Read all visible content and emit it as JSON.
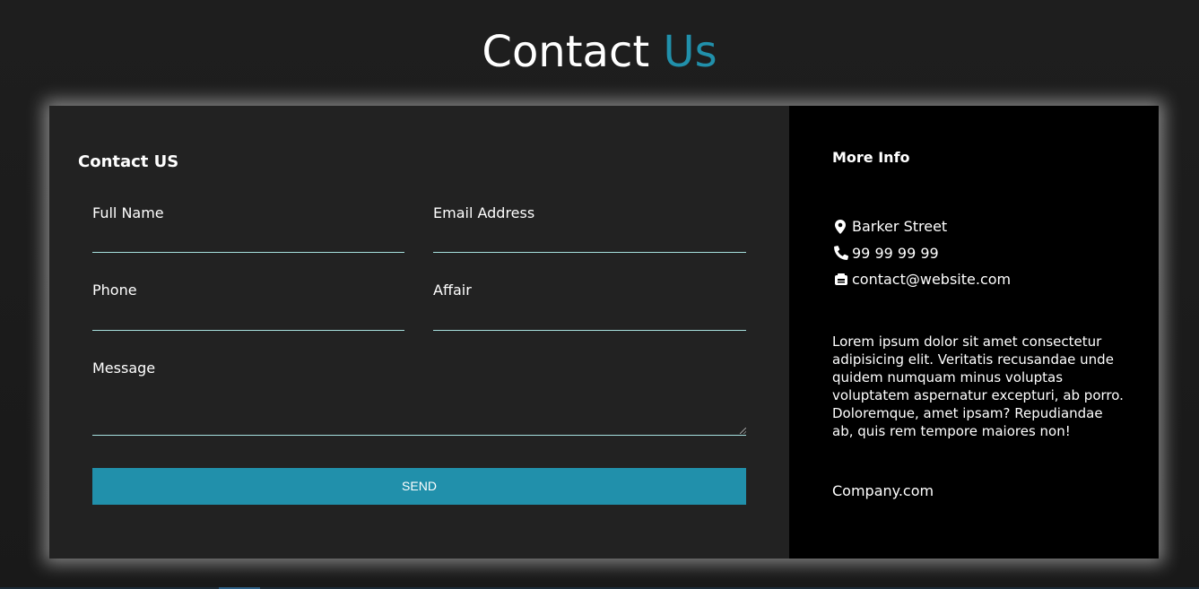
{
  "page": {
    "title_main": "Contact",
    "title_accent": "Us"
  },
  "form": {
    "heading": "Contact US",
    "fields": {
      "full_name": {
        "label": "Full Name",
        "value": ""
      },
      "email": {
        "label": "Email Address",
        "value": ""
      },
      "phone": {
        "label": "Phone",
        "value": ""
      },
      "affair": {
        "label": "Affair",
        "value": ""
      },
      "message": {
        "label": "Message",
        "value": ""
      }
    },
    "send_label": "SEND"
  },
  "info": {
    "heading": "More Info",
    "address": "Barker Street",
    "phone": "99 99 99 99",
    "email": "contact@website.com",
    "description": "Lorem ipsum dolor sit amet consectetur adipisicing elit. Veritatis recusandae unde quidem numquam minus voluptas voluptatem aspernatur excepturi, ab porro. Doloremque, amet ipsam? Repudiandae ab, quis rem tempore maiores non!",
    "footer": "Company.com",
    "icons": [
      "map-marker-icon",
      "phone-icon",
      "mail-icon"
    ]
  },
  "colors": {
    "accent": "#2190ab",
    "form_bg": "#222222",
    "info_bg": "#000000",
    "underline": "#a7e1df"
  }
}
